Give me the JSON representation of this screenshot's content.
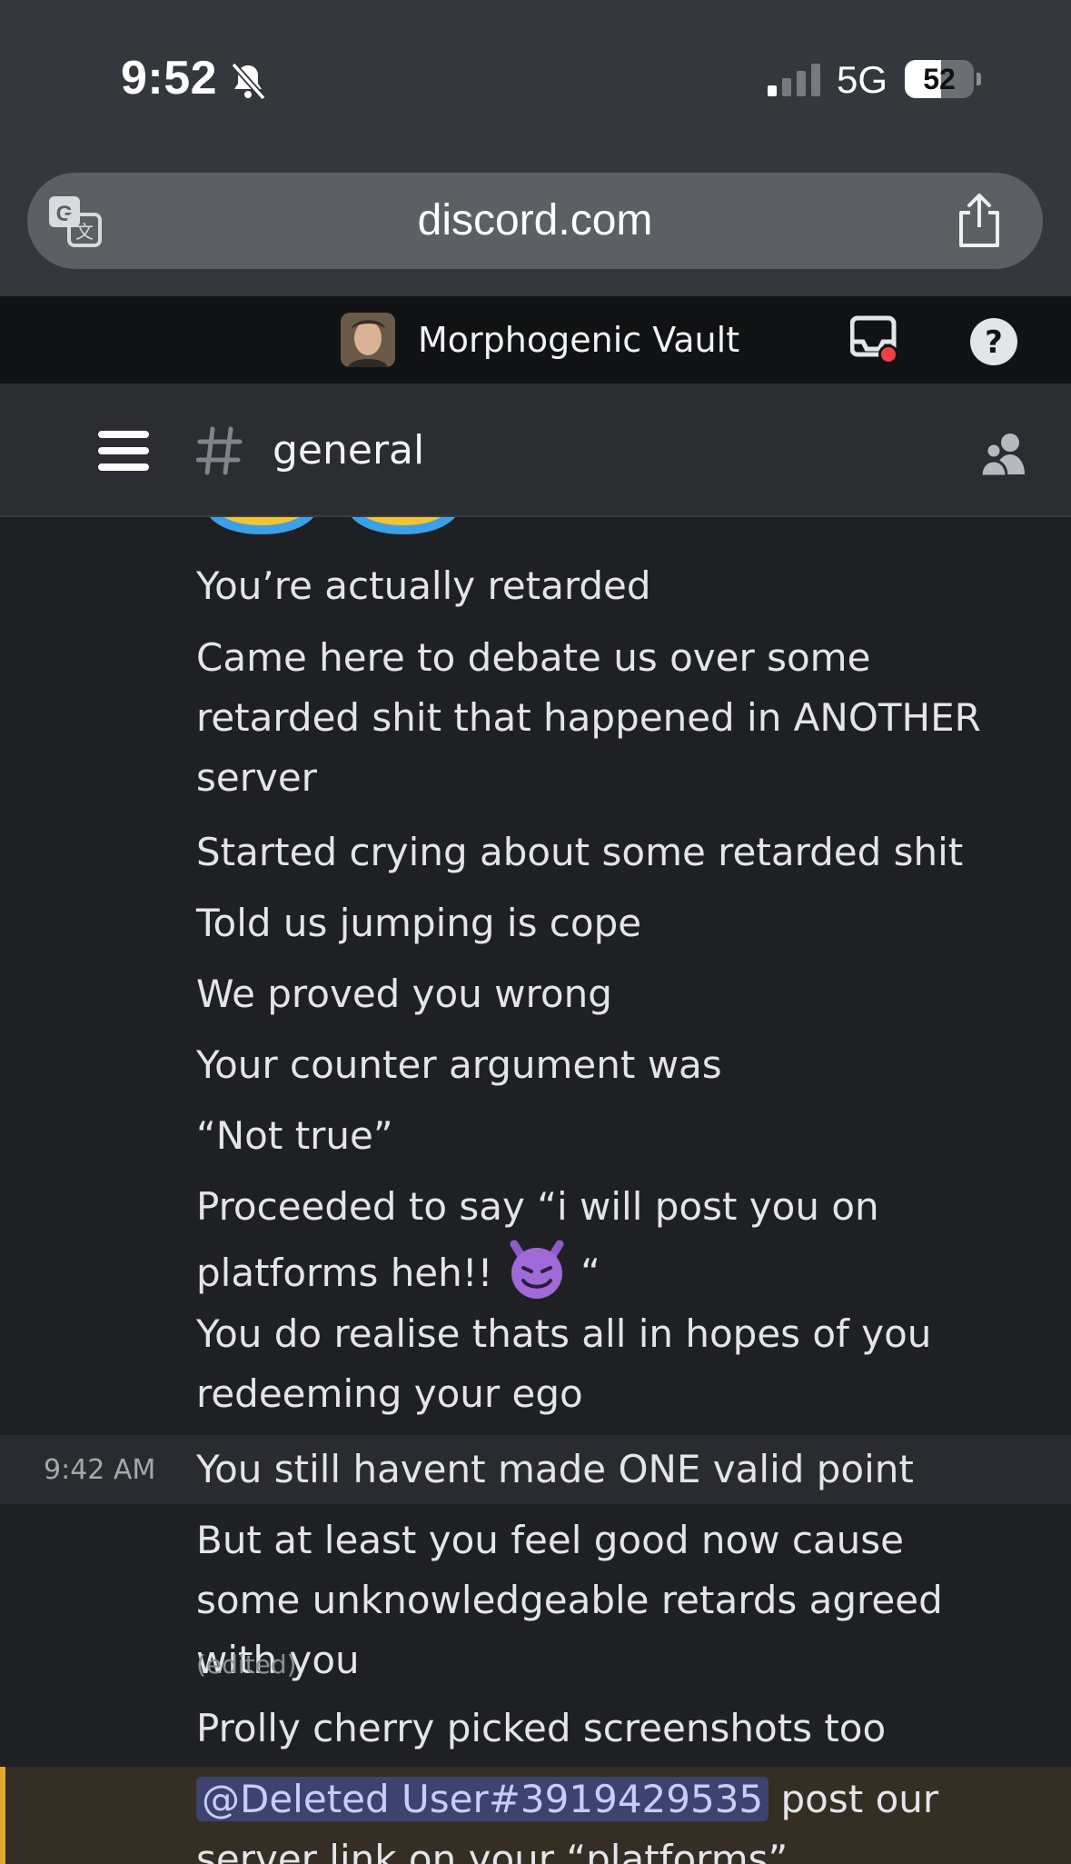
{
  "status_bar": {
    "time": "9:52",
    "network": "5G",
    "battery_percent": 52,
    "battery_label": "52"
  },
  "browser": {
    "url": "discord.com"
  },
  "server": {
    "name": "Morphogenic Vault"
  },
  "channel": {
    "name": "general"
  },
  "messages": [
    {
      "text": "You’re actually retarded"
    },
    {
      "text": "Came here to debate us over some retarded shit that happened in ANOTHER server"
    },
    {
      "text": "Started crying about some retarded shit"
    },
    {
      "text": "Told us jumping is cope"
    },
    {
      "text": "We proved you wrong"
    },
    {
      "text": "Your counter argument was"
    },
    {
      "text": "“Not true”"
    },
    {
      "text_before": "Proceeded to say “i will post you on platforms heh!!",
      "emoji": "smiling-devil",
      "text_after": "“"
    },
    {
      "text": "You do realise thats all in hopes of you redeeming your ego"
    },
    {
      "timestamp": "9:42 AM",
      "text": "You still havent made ONE valid point"
    },
    {
      "text": "But at least you feel good now cause some unknowledgeable retards agreed with you",
      "edited": "(edited)"
    },
    {
      "text": "Prolly cherry picked screenshots too"
    },
    {
      "mention": "@Deleted User#3919429535",
      "text": " post our server link on your “platforms”"
    }
  ],
  "colors": {
    "accent_mention": "#e0a82e",
    "notification_dot": "#f23f43",
    "background": "#1f2024"
  }
}
